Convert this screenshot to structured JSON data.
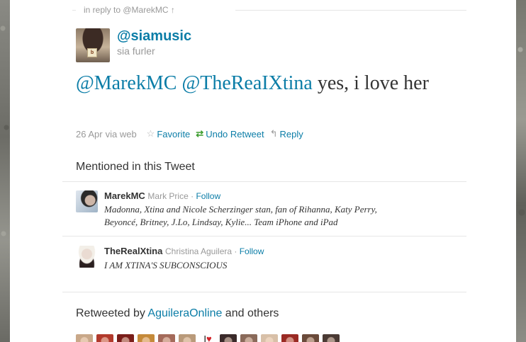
{
  "reply_context": {
    "text": "in reply to @MarekMC ↑"
  },
  "author": {
    "screen_name": "@siamusic",
    "full_name": "sia furler",
    "avatar_cube_text": "b"
  },
  "tweet": {
    "mentions": [
      "@MarekMC",
      "@TheReaIXtina"
    ],
    "text_after_mentions": " yes, i love her"
  },
  "meta": {
    "timestamp": "26 Apr",
    "source": "via web",
    "favorite_label": "Favorite",
    "undo_retweet_label": "Undo Retweet",
    "reply_label": "Reply",
    "icons": {
      "favorite": "star-icon",
      "retweet": "retweet-icon",
      "reply": "reply-arrow-icon"
    }
  },
  "mentioned_section": {
    "title": "Mentioned in this Tweet",
    "users": [
      {
        "screen_name": "MarekMC",
        "full_name": "Mark Price",
        "separator": " · ",
        "follow_label": "Follow",
        "bio": "Madonna, Xtina and Nicole Scherzinger stan, fan of Rihanna, Katy Perry, Beyoncé, Britney, J.Lo, Lindsay, Kylie... Team iPhone and iPad"
      },
      {
        "screen_name": "TheRealXtina",
        "full_name": "Christina Aguilera",
        "separator": " · ",
        "follow_label": "Follow",
        "bio": "I AM XTINA'S SUBCONSCIOUS"
      }
    ]
  },
  "retweeted_section": {
    "prefix": "Retweeted by ",
    "user": "AguileraOnline",
    "suffix": " and others",
    "heart_avatar_text": "I♥",
    "avatar_colors": [
      "#c9a889",
      "#b23a2c",
      "#7a1e1a",
      "#c58a3a",
      "#a46a5a",
      "#b99a7a",
      "#ffffff",
      "#3a2a2a",
      "#8a6a5a",
      "#d8c0a8",
      "#9a2a24",
      "#6a4a3a",
      "#4a3a34"
    ]
  },
  "colors": {
    "link": "#0b7da7",
    "text": "#333333",
    "muted": "#999999",
    "retweet_green": "#3d9d2f"
  }
}
